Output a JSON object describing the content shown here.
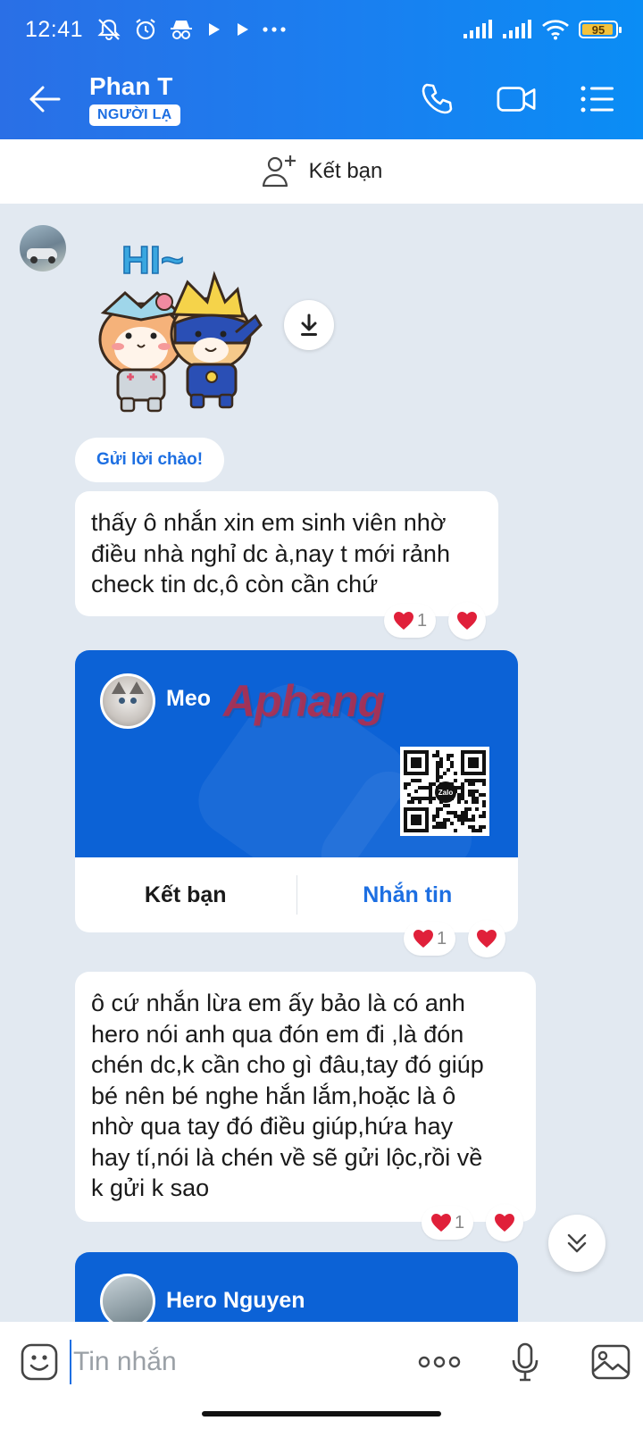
{
  "status_bar": {
    "time": "12:41",
    "icons": [
      "mute-icon",
      "alarm-icon",
      "incognito-icon",
      "play-icon",
      "play-icon",
      "more-dots-icon",
      "signal-icon",
      "signal-icon",
      "wifi-icon"
    ],
    "battery_percent": "95"
  },
  "header": {
    "contact_name": "Phan T",
    "badge": "NGƯỜI LẠ",
    "accent_color": "#1a7ff0"
  },
  "add_friend_bar": {
    "label": "Kết bạn"
  },
  "chat": {
    "greeting_chip": "Gửi lời chào!",
    "sticker_text": "HI~",
    "messages": [
      {
        "lines": [
          "thấy ô nhắn xin em sinh viên nhờ",
          "điều nhà nghỉ dc à,nay t mới rảnh",
          "check tin dc,ô còn cần chứ"
        ],
        "reaction_count": "1"
      },
      {
        "lines": [
          "ô cứ nhắn lừa em ấy bảo là có anh",
          "hero nói anh qua đón em đi ,là đón",
          "chén dc,k cần cho gì đâu,tay đó giúp",
          "bé nên bé nghe hắn lắm,hoặc là ô",
          "nhờ qua tay đó điều giúp,hứa hay",
          "hay tí,nói là chén về sẽ gửi lộc,rồi về",
          "k gửi k sao"
        ],
        "reaction_count": "1"
      }
    ],
    "contact_card": {
      "name": "Meo",
      "watermark": "Aphang",
      "qr_badge": "Zalo",
      "add_friend_label": "Kết bạn",
      "message_label": "Nhắn tin",
      "reaction_count": "1"
    },
    "contact_card_2": {
      "name": "Hero Nguyen"
    }
  },
  "input_bar": {
    "placeholder": "Tin nhắn"
  }
}
